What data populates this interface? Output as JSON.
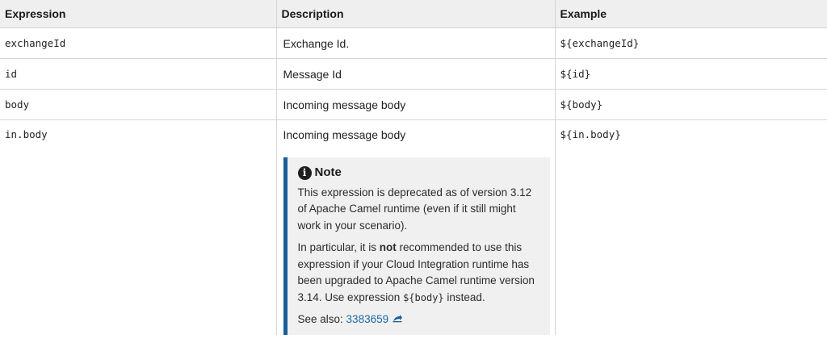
{
  "table": {
    "headers": [
      "Expression",
      "Description",
      "Example"
    ],
    "rows": [
      {
        "expression": "exchangeId",
        "description": "Exchange Id.",
        "example": "${exchangeId}"
      },
      {
        "expression": "id",
        "description": "Message Id",
        "example": "${id}"
      },
      {
        "expression": "body",
        "description": "Incoming message body",
        "example": "${body}"
      },
      {
        "expression": "in.body",
        "description": "Incoming message body",
        "example": "${in.body}"
      }
    ]
  },
  "note": {
    "title": "Note",
    "icon": "info-icon",
    "para1": "This expression is deprecated as of version 3.12 of Apache Camel runtime (even if it still might work in your scenario).",
    "para2_before": "In particular, it is ",
    "para2_bold": "not",
    "para2_middle": " recommended to use this expression if your Cloud Integration runtime has been upgraded to Apache Camel runtime version 3.14. Use expression ",
    "para2_code": "${body}",
    "para2_after": " instead.",
    "see_also_label": "See also: ",
    "see_also_link": "3383659",
    "link_icon": "external-link-icon"
  },
  "colors": {
    "header_bg": "#efefef",
    "note_bg": "#f0f0f0",
    "note_accent": "#1a5f99",
    "link": "#1a6aa6"
  }
}
